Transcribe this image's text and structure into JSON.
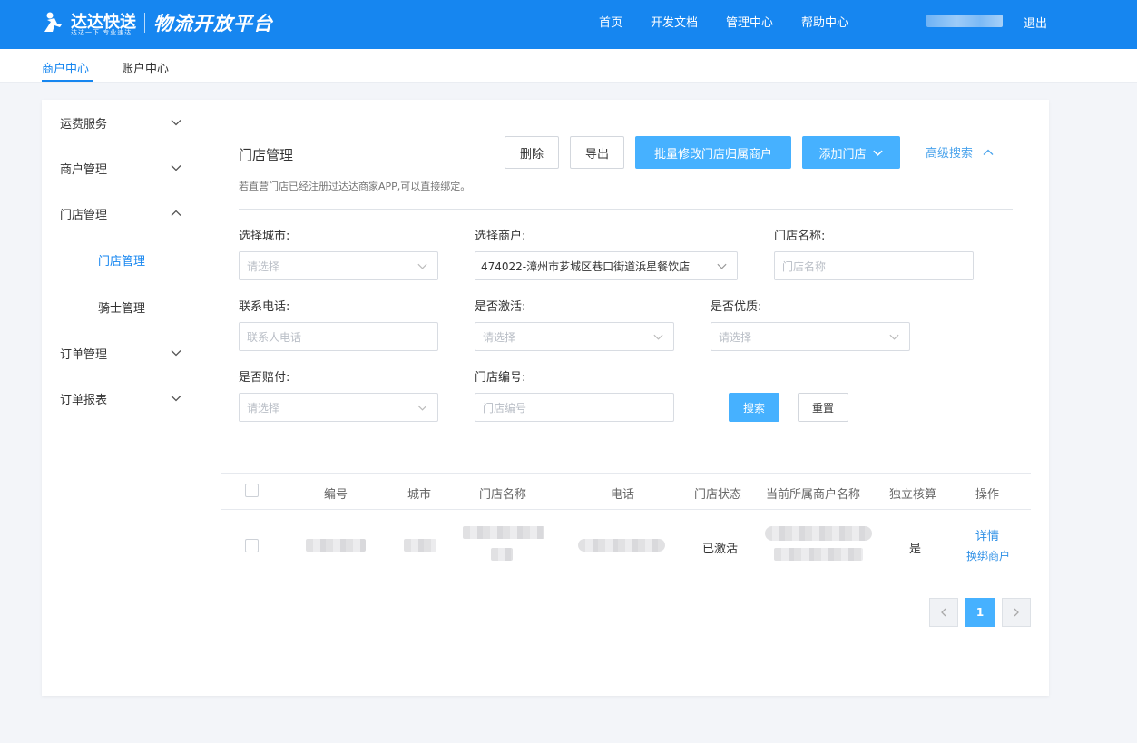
{
  "header": {
    "logo_brand": "达达快送",
    "logo_slogan": "达达一下 专业速达",
    "platform_title": "物流开放平台",
    "nav": [
      "首页",
      "开发文档",
      "管理中心",
      "帮助中心"
    ],
    "logout": "退出",
    "accent_color": "#1686f0"
  },
  "subnav": {
    "tabs": [
      "商户中心",
      "账户中心"
    ],
    "active_tab": "商户中心"
  },
  "sidebar": {
    "items": [
      {
        "label": "运费服务",
        "expanded": false
      },
      {
        "label": "商户管理",
        "expanded": false
      },
      {
        "label": "门店管理",
        "expanded": true
      },
      {
        "label": "订单管理",
        "expanded": false
      },
      {
        "label": "订单报表",
        "expanded": false
      }
    ],
    "sub_items": [
      {
        "label": "门店管理",
        "active": true
      },
      {
        "label": "骑士管理",
        "active": false
      }
    ]
  },
  "main": {
    "title": "门店管理",
    "hint": "若直营门店已经注册过达达商家APP,可以直接绑定。",
    "buttons": {
      "delete": "删除",
      "export": "导出",
      "batch_modify": "批量修改门店归属商户",
      "add_store": "添加门店",
      "advanced_search": "高级搜索"
    }
  },
  "filters": {
    "city": {
      "label": "选择城市:",
      "placeholder": "请选择"
    },
    "merchant": {
      "label": "选择商户:",
      "value": "474022-漳州市芗城区巷口街道浜星餐饮店"
    },
    "store_name": {
      "label": "门店名称:",
      "placeholder": "门店名称"
    },
    "phone": {
      "label": "联系电话:",
      "placeholder": "联系人电话"
    },
    "activated": {
      "label": "是否激活:",
      "placeholder": "请选择"
    },
    "quality": {
      "label": "是否优质:",
      "placeholder": "请选择"
    },
    "compensate": {
      "label": "是否赔付:",
      "placeholder": "请选择"
    },
    "store_no": {
      "label": "门店编号:",
      "placeholder": "门店编号"
    },
    "search_btn": "搜索",
    "reset_btn": "重置"
  },
  "table": {
    "headers": [
      "编号",
      "城市",
      "门店名称",
      "电话",
      "门店状态",
      "当前所属商户名称",
      "独立核算",
      "操作"
    ],
    "rows": [
      {
        "status": "已激活",
        "independent": "是",
        "actions": [
          "详情",
          "换绑商户"
        ]
      }
    ]
  },
  "pagination": {
    "current": "1",
    "prev_icon": "chevron-left-icon",
    "next_icon": "chevron-right-icon"
  }
}
